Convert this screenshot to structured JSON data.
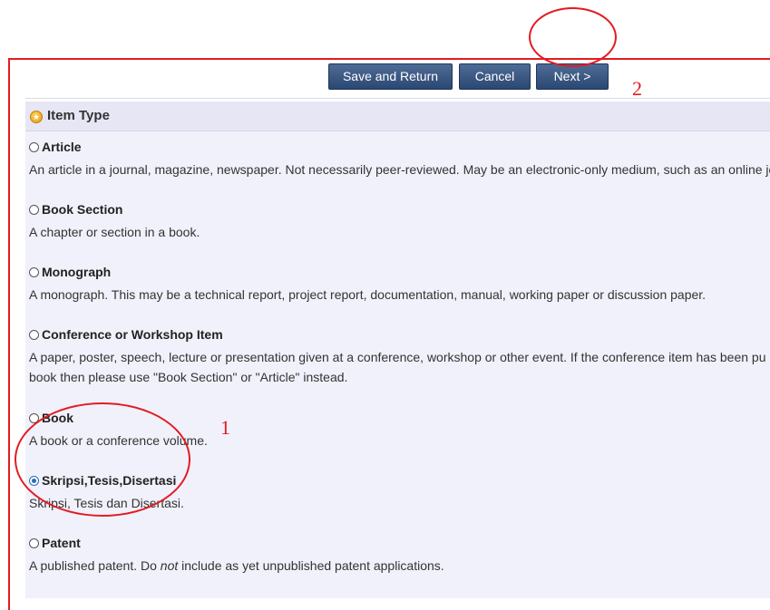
{
  "toolbar": {
    "save_return_label": "Save and Return",
    "cancel_label": "Cancel",
    "next_label": "Next >"
  },
  "section": {
    "title": "Item Type",
    "icon": "star-icon"
  },
  "item_types": [
    {
      "label": "Article",
      "selected": false,
      "description": "An article in a journal, magazine, newspaper. Not necessarily peer-reviewed. May be an electronic-only medium, such as an online jo"
    },
    {
      "label": "Book Section",
      "selected": false,
      "description": "A chapter or section in a book."
    },
    {
      "label": "Monograph",
      "selected": false,
      "description": "A monograph. This may be a technical report, project report, documentation, manual, working paper or discussion paper."
    },
    {
      "label": "Conference or Workshop Item",
      "selected": false,
      "description": "A paper, poster, speech, lecture or presentation given at a conference, workshop or other event. If the conference item has been pu",
      "description_line2": "book then please use \"Book Section\" or \"Article\" instead."
    },
    {
      "label": "Book",
      "selected": false,
      "description": "A book or a conference volume."
    },
    {
      "label": "Skripsi,Tesis,Disertasi",
      "selected": true,
      "description": "Skripsi, Tesis dan Disertasi."
    },
    {
      "label": "Patent",
      "selected": false,
      "description_before": "A published patent. Do ",
      "description_em": "not",
      "description_after": " include as yet unpublished patent applications."
    }
  ],
  "annotations": {
    "step1": "1",
    "step2": "2"
  },
  "colors": {
    "annotation_red": "#e31b23",
    "button_blue": "#2b4773",
    "panel_bg": "#f1f1fb",
    "radio_selected": "#2a6db8"
  }
}
